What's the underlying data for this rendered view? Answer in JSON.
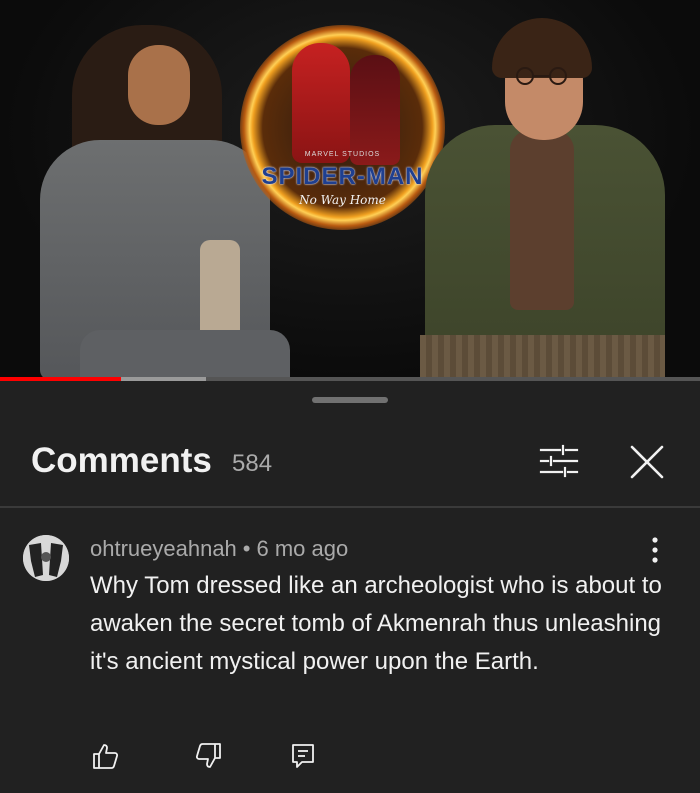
{
  "video": {
    "poster_studio": "MARVEL STUDIOS",
    "poster_title": "SPIDER-MAN",
    "poster_subtitle": "No Way Home",
    "progress_played": 0.173,
    "progress_buffered": 0.294
  },
  "comments_panel": {
    "title": "Comments",
    "count": "584",
    "icons": {
      "filter": "filter-sliders-icon",
      "close": "close-icon",
      "more": "more-vertical-icon",
      "like": "thumbs-up-icon",
      "dislike": "thumbs-down-icon",
      "reply": "reply-icon"
    },
    "comment": {
      "author": "ohtrueyeahnah",
      "separator": "•",
      "time": "6 mo ago",
      "text": "Why Tom dressed like an archeologist who is about to awaken the secret tomb of Akmenrah thus unleashing it's ancient mystical power upon the Earth."
    }
  },
  "colors": {
    "panel_bg": "#212121",
    "progress_played": "#ff0000",
    "text_primary": "#f1f1f1",
    "text_secondary": "#aaaaaa"
  }
}
